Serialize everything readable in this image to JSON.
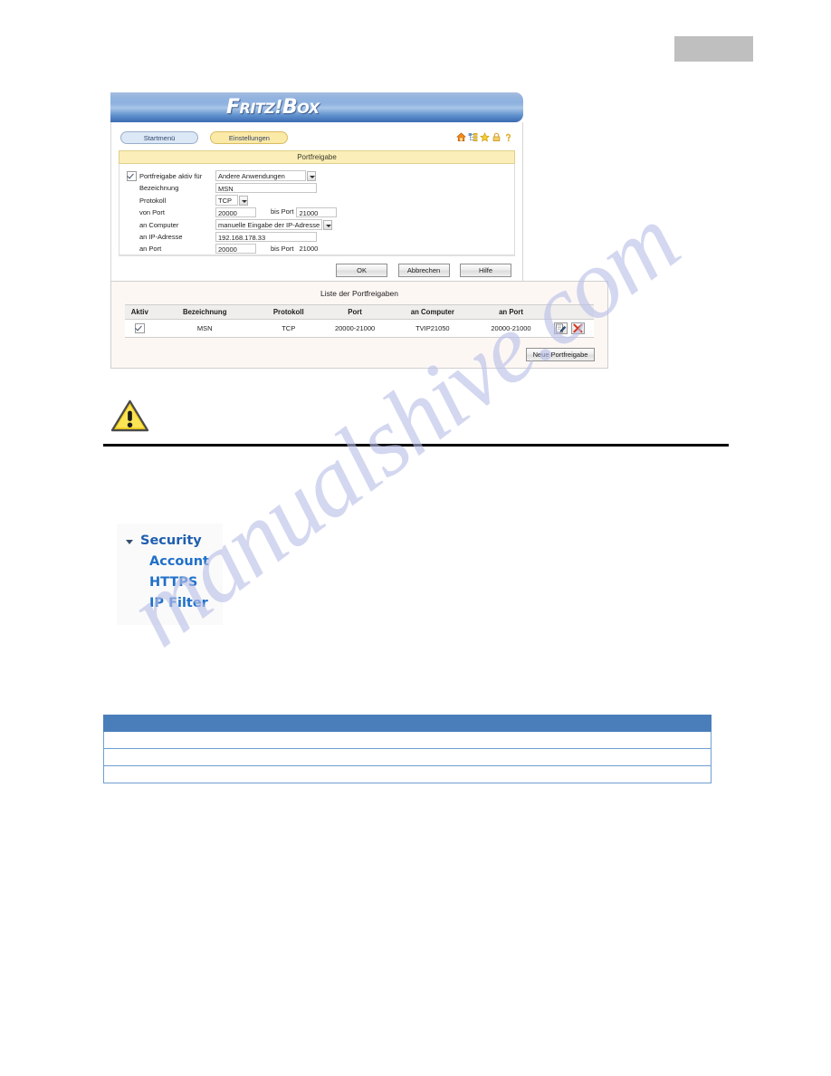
{
  "page": {
    "watermark_text": "manualshive.com",
    "gray_block": {
      "name": "header-gray-block",
      "color": "#bfbfbf"
    }
  },
  "fritzbox": {
    "logo": {
      "part1": "F",
      "part2": "RITZ",
      "bang": "!",
      "part3": "B",
      "part4": "ox",
      "full": "FRITZ!Box"
    },
    "tabs": [
      {
        "label": "Startmenü",
        "active": false
      },
      {
        "label": "Einstellungen",
        "active": true
      }
    ],
    "tool_icons": [
      {
        "name": "home-icon",
        "color": "#e8761a"
      },
      {
        "name": "sitemap-icon",
        "color": "#7fa8d8"
      },
      {
        "name": "favorites-star-icon",
        "color": "#f2c623"
      },
      {
        "name": "logout-lock-icon",
        "color": "#e6a83c"
      },
      {
        "name": "help-question-icon",
        "color": "#e0b23a"
      }
    ],
    "section_title": "Portfreigabe",
    "form": {
      "activate": {
        "checked": true,
        "label": "Portfreigabe aktiv für",
        "select_value": "Andere Anwendungen"
      },
      "bezeichnung": {
        "label": "Bezeichnung",
        "value": "MSN"
      },
      "protokoll": {
        "label": "Protokoll",
        "value": "TCP"
      },
      "von_port": {
        "label": "von Port",
        "value": "20000",
        "bis_label": "bis Port",
        "bis_value": "21000"
      },
      "an_computer": {
        "label": "an Computer",
        "select_value": "manuelle Eingabe der IP-Adresse"
      },
      "an_ip": {
        "label": "an IP-Adresse",
        "value": "192.168.178.33"
      },
      "an_port": {
        "label": "an Port",
        "value": "20000",
        "bis_label": "bis Port",
        "bis_value": "21000"
      }
    },
    "buttons": {
      "ok": "OK",
      "cancel": "Abbrechen",
      "help": "Hilfe"
    }
  },
  "list_panel": {
    "title": "Liste der Portfreigaben",
    "columns": [
      "Aktiv",
      "Bezeichnung",
      "Protokoll",
      "Port",
      "an Computer",
      "an Port"
    ],
    "rows": [
      {
        "aktiv": true,
        "bezeichnung": "MSN",
        "protokoll": "TCP",
        "port": "20000-21000",
        "an_computer": "TVIP21050",
        "an_port": "20000-21000"
      }
    ],
    "row_actions": [
      {
        "name": "edit-row-icon"
      },
      {
        "name": "delete-row-icon"
      }
    ],
    "new_button": "Neue Portfreigabe"
  },
  "security_menu": {
    "root": {
      "label": "Security",
      "expanded": true
    },
    "items": [
      {
        "label": "Account"
      },
      {
        "label": "HTTPS"
      },
      {
        "label": "IP Filter"
      }
    ],
    "accent_color": "#2070c8"
  },
  "bottom_table": {
    "header_color": "#4a7ebb",
    "border_color": "#6f9ed0",
    "header_cells": [
      ""
    ],
    "rows": [
      [
        ""
      ],
      [
        ""
      ],
      [
        ""
      ]
    ]
  }
}
